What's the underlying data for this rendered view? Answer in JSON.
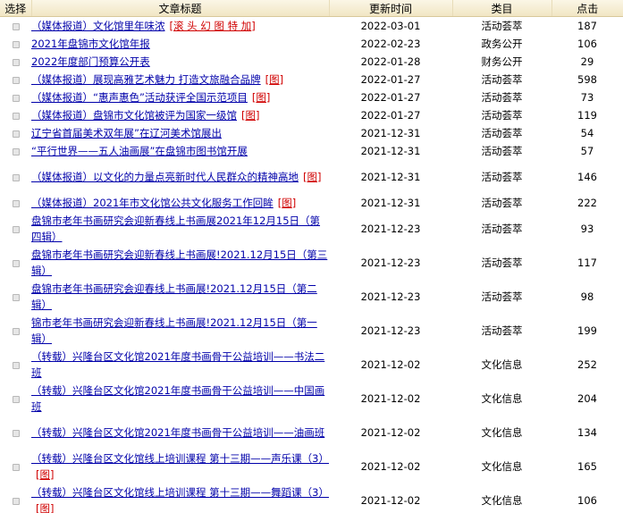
{
  "table": {
    "headers": {
      "select": "选择",
      "title": "文章标题",
      "updated": "更新时间",
      "category": "类目",
      "clicks": "点击"
    },
    "rows": [
      {
        "title": "（媒体报道）文化馆里年味浓",
        "tag": "滚 头 幻 图 特 加",
        "date": "2022-03-01",
        "category": "活动荟萃",
        "clicks": "187"
      },
      {
        "title": "2021年盘锦市文化馆年报",
        "tag": "",
        "date": "2022-02-23",
        "category": "政务公开",
        "clicks": "106"
      },
      {
        "title": "2022年度部门预算公开表",
        "tag": "",
        "date": "2022-01-28",
        "category": "财务公开",
        "clicks": "29"
      },
      {
        "title": "（媒体报道）展现高雅艺术魅力 打造文旅融合品牌",
        "tag": "图",
        "date": "2022-01-27",
        "category": "活动荟萃",
        "clicks": "598"
      },
      {
        "title": "（媒体报道）“惠声惠色”活动获评全国示范项目",
        "tag": "图",
        "date": "2022-01-27",
        "category": "活动荟萃",
        "clicks": "73"
      },
      {
        "title": "（媒体报道）盘锦市文化馆被评为国家一级馆",
        "tag": "图",
        "date": "2022-01-27",
        "category": "活动荟萃",
        "clicks": "119"
      },
      {
        "title": "辽宁省首届美术双年展”在辽河美术馆展出",
        "tag": "",
        "date": "2021-12-31",
        "category": "活动荟萃",
        "clicks": "54"
      },
      {
        "title": "“平行世界——五人油画展”在盘锦市图书馆开展",
        "tag": "",
        "date": "2021-12-31",
        "category": "活动荟萃",
        "clicks": "57"
      },
      {
        "title": "（媒体报道）以文化的力量点亮新时代人民群众的精神高地",
        "tag": "图",
        "date": "2021-12-31",
        "category": "活动荟萃",
        "clicks": "146"
      },
      {
        "title": "（媒体报道）2021年市文化馆公共文化服务工作回眸",
        "tag": "图",
        "date": "2021-12-31",
        "category": "活动荟萃",
        "clicks": "222"
      },
      {
        "title": "盘锦市老年书画研究会迎新春线上书画展2021年12月15日（第四辑）",
        "tag": "",
        "date": "2021-12-23",
        "category": "活动荟萃",
        "clicks": "93"
      },
      {
        "title": "盘锦市老年书画研究会迎新春线上书画展!2021.12月15日（第三辑）",
        "tag": "",
        "date": "2021-12-23",
        "category": "活动荟萃",
        "clicks": "117"
      },
      {
        "title": "盘锦市老年书画研究会迎春线上书画展!2021.12月15日（第二辑）",
        "tag": "",
        "date": "2021-12-23",
        "category": "活动荟萃",
        "clicks": "98"
      },
      {
        "title": "锦市老年书画研究会迎新春线上书画展!2021.12月15日（第一辑）",
        "tag": "",
        "date": "2021-12-23",
        "category": "活动荟萃",
        "clicks": "199"
      },
      {
        "title": "（转载）兴隆台区文化馆2021年度书画骨干公益培训——书法二班",
        "tag": "",
        "date": "2021-12-02",
        "category": "文化信息",
        "clicks": "252"
      },
      {
        "title": "（转载）兴隆台区文化馆2021年度书画骨干公益培训——中国画班",
        "tag": "",
        "date": "2021-12-02",
        "category": "文化信息",
        "clicks": "204"
      },
      {
        "title": "（转载）兴隆台区文化馆2021年度书画骨干公益培训——油画班",
        "tag": "",
        "date": "2021-12-02",
        "category": "文化信息",
        "clicks": "134"
      },
      {
        "title": "（转载）兴隆台区文化馆线上培训课程 第十三期——声乐课（3）",
        "tag": "图",
        "date": "2021-12-02",
        "category": "文化信息",
        "clicks": "165"
      },
      {
        "title": "（转载）兴隆台区文化馆线上培训课程 第十三期——舞蹈课（3）",
        "tag": "图",
        "date": "2021-12-02",
        "category": "文化信息",
        "clicks": "106"
      }
    ]
  }
}
